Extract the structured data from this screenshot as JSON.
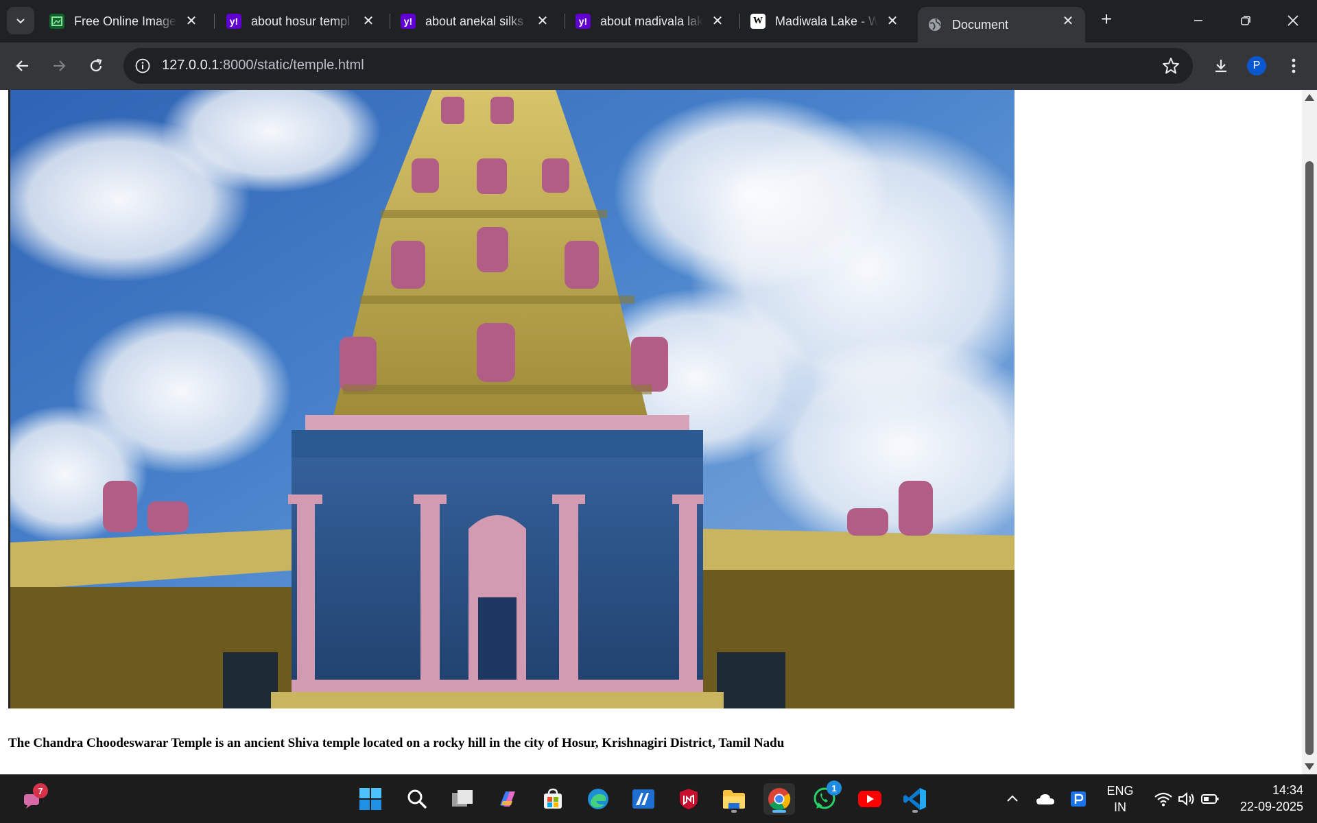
{
  "browser": {
    "tabs": [
      {
        "title": "Free Online Image",
        "favicon": "image-favicon",
        "fav_color": "#1a7f37"
      },
      {
        "title": "about hosur templ",
        "favicon": "yahoo-favicon",
        "fav_color": "#6001d2"
      },
      {
        "title": "about anekal silks",
        "favicon": "yahoo-favicon",
        "fav_color": "#6001d2"
      },
      {
        "title": "about madivala lak",
        "favicon": "yahoo-favicon",
        "fav_color": "#6001d2"
      },
      {
        "title": "Madiwala Lake - W",
        "favicon": "wikipedia-favicon",
        "fav_color": "#ffffff"
      },
      {
        "title": "Document",
        "favicon": "globe-favicon",
        "fav_color": "#9aa0a6"
      }
    ],
    "fav_letters": {
      "yahoo": "y!",
      "wikipedia": "W"
    },
    "address": {
      "host": "127.0.0.1",
      "rest": ":8000/static/temple.html"
    },
    "profile_initial": "P"
  },
  "page": {
    "caption": "The Chandra Choodeswarar Temple is an ancient Shiva temple located on a rocky hill in the city of Hosur, Krishnagiri District, Tamil Nadu",
    "image_alt": "Temple gopuram against a cloudy blue sky"
  },
  "taskbar": {
    "notification_badge": "7",
    "whatsapp_badge": "1",
    "language": "ENG",
    "region": "IN",
    "time": "14:34",
    "date": "22-09-2025"
  }
}
